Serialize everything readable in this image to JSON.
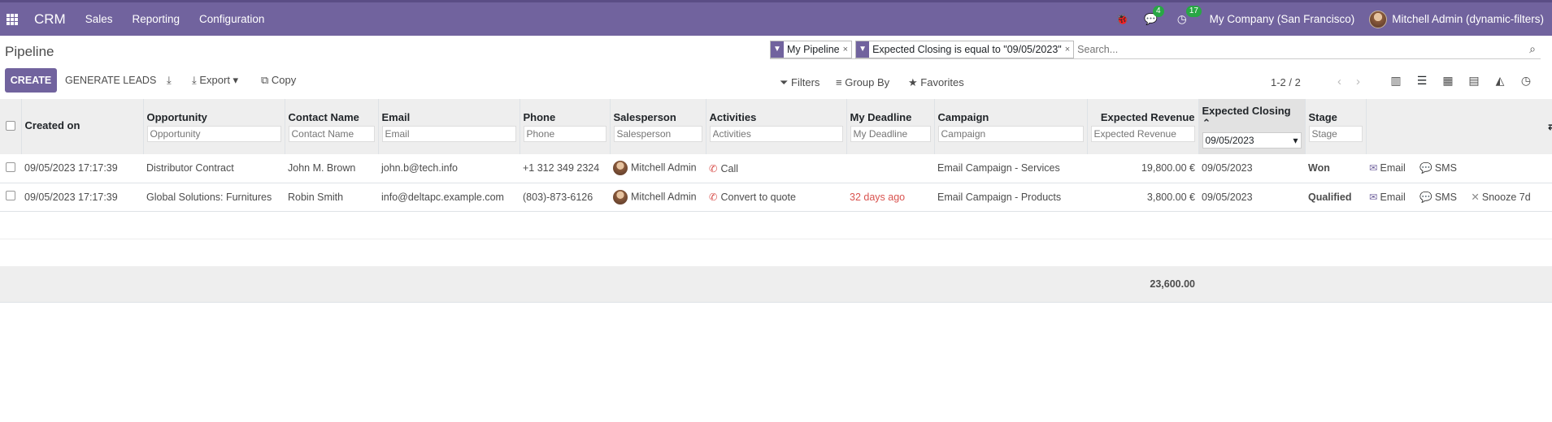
{
  "topbar": {
    "app": "CRM",
    "menus": [
      "Sales",
      "Reporting",
      "Configuration"
    ],
    "messages_count": "4",
    "activities_count": "17",
    "company": "My Company (San Francisco)",
    "user": "Mitchell Admin (dynamic-filters)"
  },
  "control": {
    "title": "Pipeline",
    "create": "CREATE",
    "generate": "GENERATE LEADS",
    "export": "Export",
    "copy": "Copy",
    "facet1": "My Pipeline",
    "facet2": "Expected Closing is equal to \"09/05/2023\"",
    "search_placeholder": "Search...",
    "filters": "Filters",
    "groupby": "Group By",
    "favorites": "Favorites",
    "pager": "1-2 / 2"
  },
  "columns": {
    "created_on": "Created on",
    "opportunity": "Opportunity",
    "contact": "Contact Name",
    "email": "Email",
    "phone": "Phone",
    "salesperson": "Salesperson",
    "activities": "Activities",
    "deadline": "My Deadline",
    "campaign": "Campaign",
    "revenue": "Expected Revenue",
    "closing": "Expected Closing",
    "stage": "Stage",
    "closing_filter": "09/05/2023"
  },
  "rows": [
    {
      "created_on": "09/05/2023 17:17:39",
      "opportunity": "Distributor Contract",
      "contact": "John M. Brown",
      "email": "john.b@tech.info",
      "phone": "+1 312 349 2324",
      "salesperson": "Mitchell Admin",
      "activity": "Call",
      "deadline": "",
      "campaign": "Email Campaign - Services",
      "revenue": "19,800.00 €",
      "closing": "09/05/2023",
      "stage": "Won",
      "email_btn": "Email",
      "sms_btn": "SMS"
    },
    {
      "created_on": "09/05/2023 17:17:39",
      "opportunity": "Global Solutions: Furnitures",
      "contact": "Robin Smith",
      "email": "info@deltapc.example.com",
      "phone": "(803)-873-6126",
      "salesperson": "Mitchell Admin",
      "activity": "Convert to quote",
      "deadline": "32 days ago",
      "campaign": "Email Campaign - Products",
      "revenue": "3,800.00 €",
      "closing": "09/05/2023",
      "stage": "Qualified",
      "email_btn": "Email",
      "sms_btn": "SMS",
      "snooze_btn": "Snooze 7d"
    }
  ],
  "footer": {
    "total_revenue": "23,600.00"
  }
}
